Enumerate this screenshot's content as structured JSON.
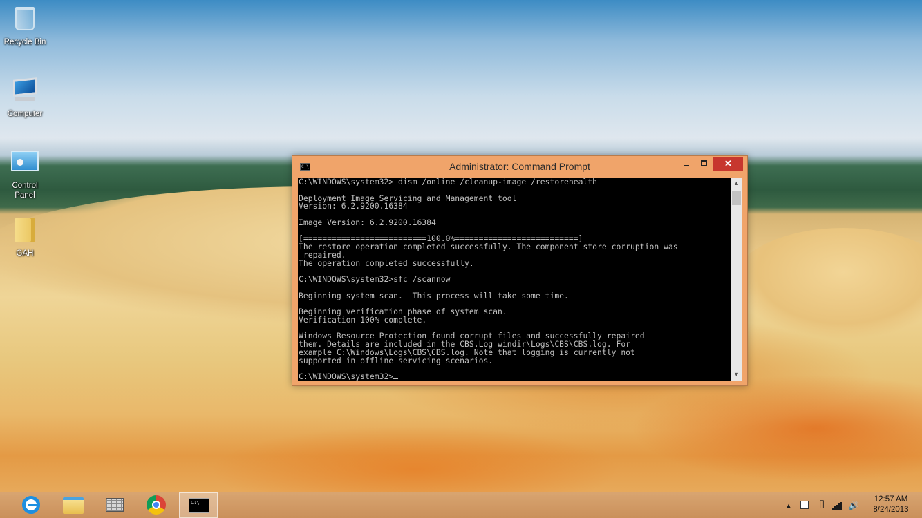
{
  "desktop": {
    "icons": [
      {
        "label": "Recycle Bin",
        "icon": "recycle-bin-icon"
      },
      {
        "label": "Computer",
        "icon": "computer-icon"
      },
      {
        "label": "Control\nPanel",
        "icon": "control-panel-icon"
      },
      {
        "label": "GAH",
        "icon": "folder-icon"
      }
    ]
  },
  "window": {
    "title": "Administrator: Command Prompt",
    "app_icon_text": "C:\\",
    "controls": {
      "minimize": "—",
      "maximize": "□",
      "close": "✕"
    },
    "console_text": "C:\\WINDOWS\\system32> dism /online /cleanup-image /restorehealth\n\nDeployment Image Servicing and Management tool\nVersion: 6.2.9200.16384\n\nImage Version: 6.2.9200.16384\n\n[==========================100.0%==========================]\nThe restore operation completed successfully. The component store corruption was\n repaired.\nThe operation completed successfully.\n\nC:\\WINDOWS\\system32>sfc /scannow\n\nBeginning system scan.  This process will take some time.\n\nBeginning verification phase of system scan.\nVerification 100% complete.\n\nWindows Resource Protection found corrupt files and successfully repaired\nthem. Details are included in the CBS.Log windir\\Logs\\CBS\\CBS.log. For\nexample C:\\Windows\\Logs\\CBS\\CBS.log. Note that logging is currently not\nsupported in offline servicing scenarios.\n\n",
    "prompt": "C:\\WINDOWS\\system32>",
    "scrollbar": {
      "up": "▲",
      "down": "▼"
    }
  },
  "taskbar": {
    "pinned": [
      {
        "icon": "internet-explorer-icon",
        "active": false
      },
      {
        "icon": "file-explorer-icon",
        "active": false
      },
      {
        "icon": "firewall-icon",
        "active": false
      },
      {
        "icon": "chrome-icon",
        "active": false
      },
      {
        "icon": "command-prompt-icon",
        "active": true
      }
    ],
    "tray": {
      "show_hidden": "▲",
      "icons": [
        "action-center-flag-icon",
        "power-icon",
        "network-icon",
        "volume-icon"
      ],
      "volume_glyph": "🔊",
      "power_glyph": "▯"
    },
    "clock": {
      "time": "12:57 AM",
      "date": "8/24/2013"
    }
  },
  "colors": {
    "window_frame": "#f0a46a",
    "close_button": "#c7372e",
    "console_bg": "#000000",
    "console_text": "#c0c0c0"
  }
}
